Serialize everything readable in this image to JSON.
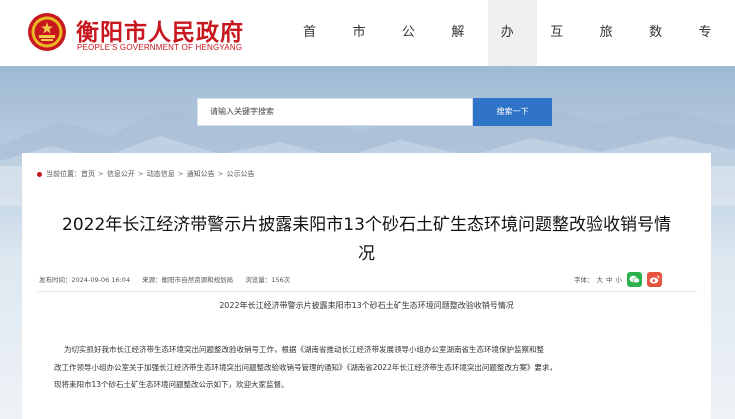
{
  "header": {
    "site_name": "衡阳市人民政府",
    "site_name_en": "PEOPLE'S GOVERNMENT OF HENGYANG",
    "nav": [
      "首页",
      "市情",
      "公开",
      "解读",
      "办事",
      "互动",
      "旅游",
      "数据",
      "专题"
    ],
    "active_nav": "办事"
  },
  "search": {
    "placeholder": "请输入关键字搜索",
    "button_label": "搜索一下"
  },
  "breadcrumb": {
    "prefix": "当前位置：",
    "items": [
      "首页",
      "信息公开",
      "动态信息",
      "通知公告",
      "公示公告"
    ],
    "separator": ">"
  },
  "article": {
    "title_line1": "2022年长江经济带警示片披露耒阳市13个砂石土矿生态环境问题整改验收销号情",
    "title_line2": "况",
    "publish_time": "发布时间：2024-09-06 16:04",
    "source": "来源：衡阳市自然资源和规划局",
    "views": "浏览量：156次",
    "font_size_label": "字体：",
    "font_sizes": [
      "大",
      "中",
      "小"
    ],
    "subtitle": "2022年长江经济带警示片披露耒阳市13个砂石土矿生态环境问题整改验收销号情况",
    "paragraph_lines": [
      "为切实抓好我市长江经济带生态环境突出问题整改验收销号工作，根据《湖南省推动长江经济带发展领导小组办公室湖南省生态环境保护监察和整",
      "改工作领导小组办公室关于加强长江经济带生态环境突出问题整改验收销号管理的通知》《湖南省2022年长江经济带生态环境突出问题整改方案》要求，",
      "现将耒阳市13个砂石土矿生态环境问题整改公示如下，欢迎大家监督。"
    ]
  },
  "colors": {
    "brand_red": "#c8171e",
    "search_blue": "#2f74c6",
    "wechat_green": "#2bb24c",
    "weibo_red": "#e6543f"
  },
  "icons": [
    "emblem-icon",
    "pin-icon",
    "wechat-icon",
    "weibo-icon"
  ]
}
